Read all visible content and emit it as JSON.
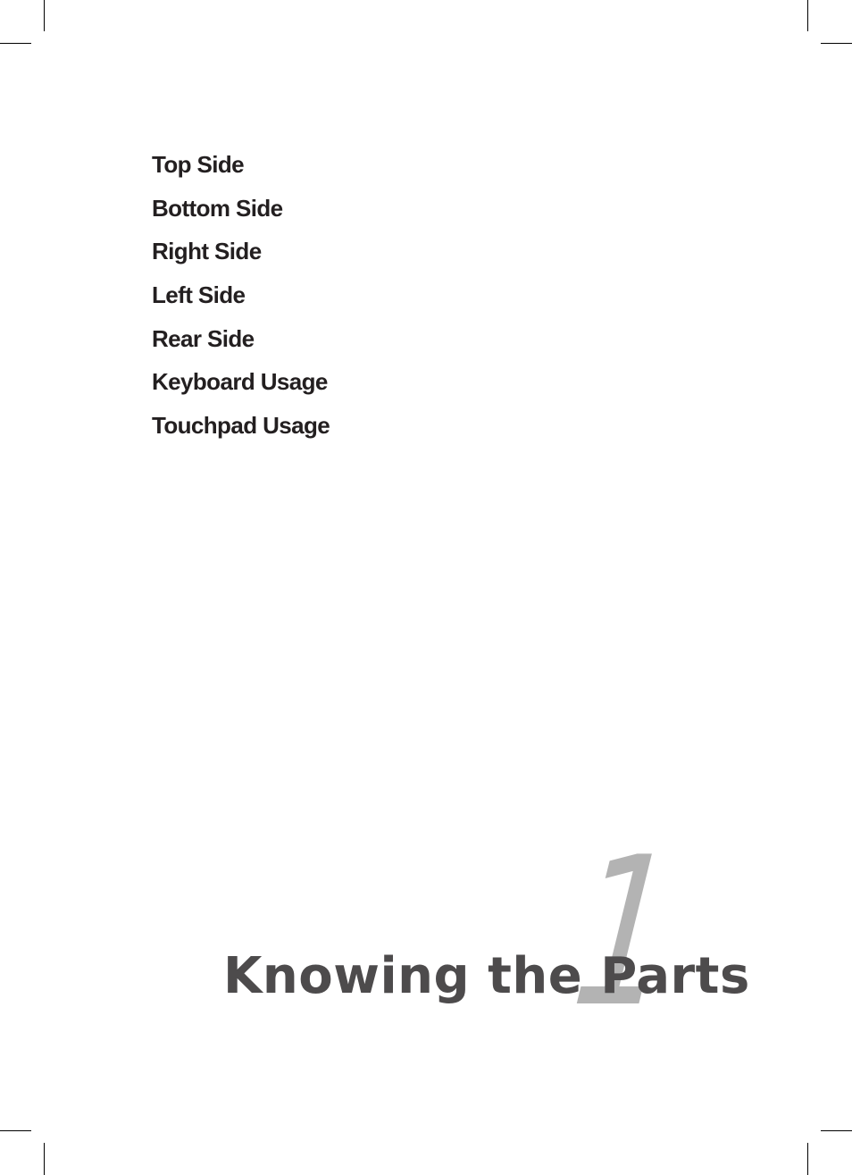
{
  "toc": {
    "items": [
      {
        "label": "Top Side"
      },
      {
        "label": "Bottom Side"
      },
      {
        "label": "Right Side"
      },
      {
        "label": "Left Side"
      },
      {
        "label": "Rear Side"
      },
      {
        "label": "Keyboard Usage"
      },
      {
        "label": "Touchpad Usage"
      }
    ]
  },
  "chapter": {
    "number": "1",
    "title": "Knowing the Parts"
  },
  "colors": {
    "toc_text": "#231f20",
    "title_text": "#4d4b4c",
    "number_text": "#b3b3b3"
  }
}
